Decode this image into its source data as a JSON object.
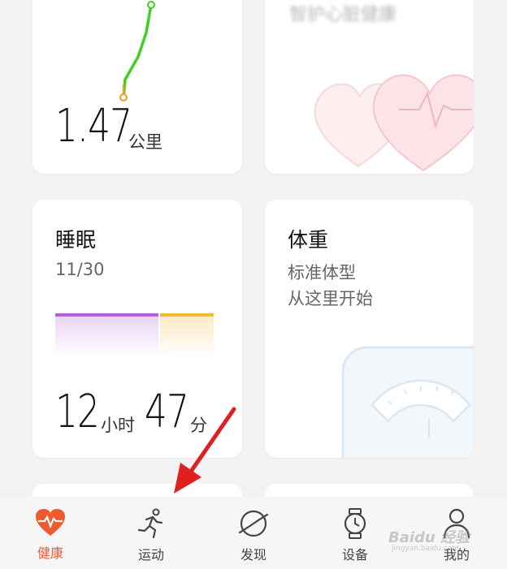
{
  "distance_card": {
    "value": "1.47",
    "unit": "公里"
  },
  "heart_card": {
    "title_faded": "智护心脏健康"
  },
  "sleep_card": {
    "title": "睡眠",
    "date": "11/30",
    "hours": "12",
    "hours_unit": "小时",
    "minutes": "47",
    "minutes_unit": "分",
    "deep_color": "#b45ee0",
    "light_color": "#f0bb2c"
  },
  "weight_card": {
    "title": "体重",
    "subtitle_line1": "标准体型",
    "subtitle_line2": "从这里开始"
  },
  "nav": {
    "items": [
      {
        "label": "健康",
        "icon": "heart-pulse-icon",
        "active": true
      },
      {
        "label": "运动",
        "icon": "running-icon",
        "active": false
      },
      {
        "label": "发现",
        "icon": "planet-icon",
        "active": false
      },
      {
        "label": "设备",
        "icon": "watch-icon",
        "active": false
      },
      {
        "label": "我的",
        "icon": "person-icon",
        "active": false
      }
    ]
  },
  "colors": {
    "accent": "#ef5a2e",
    "route_start": "#f0a020",
    "route_line": "#40d020"
  },
  "watermark": {
    "text": "Baidu 经验",
    "sub": "jingyan.baidu.com"
  }
}
